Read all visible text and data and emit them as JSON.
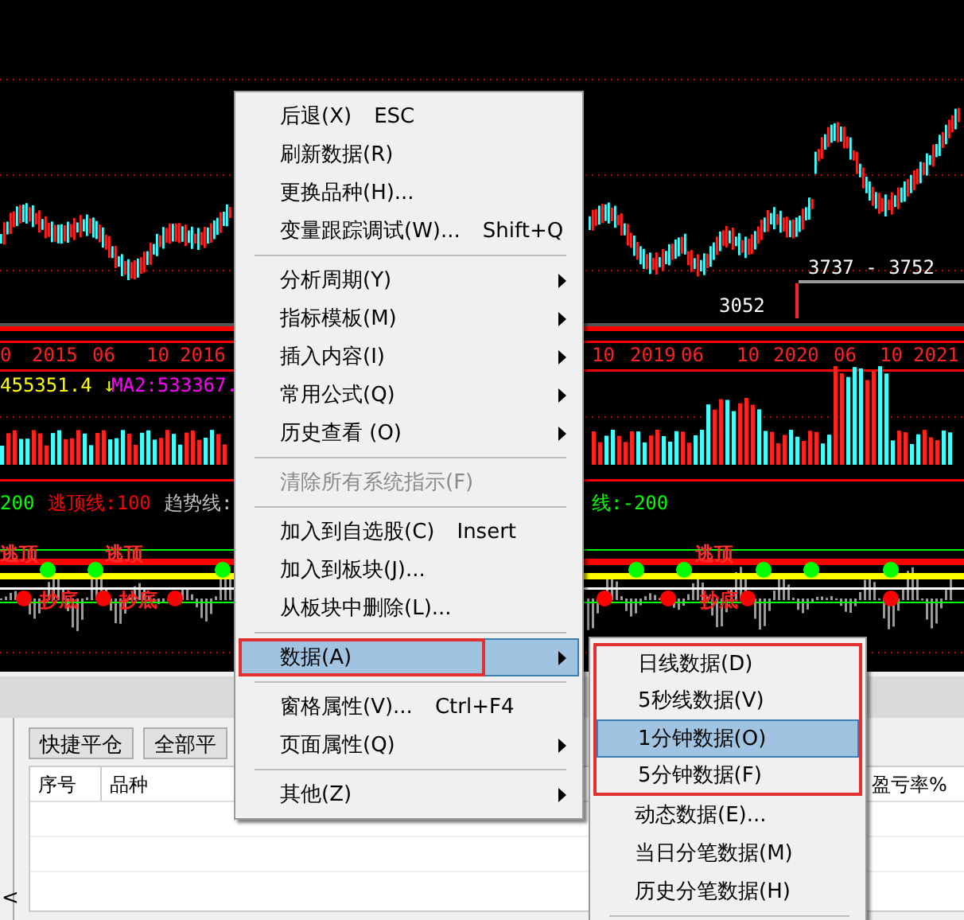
{
  "chart": {
    "price_labels": [
      {
        "text": "3737 - 3752",
        "kind": "range"
      },
      {
        "text": "3052",
        "kind": "low"
      }
    ],
    "timeline": [
      "0",
      "2015",
      "06",
      "10",
      "2016",
      "10",
      "2019",
      "06",
      "10",
      "2020",
      "06",
      "10",
      "2021"
    ],
    "volume_legend": [
      {
        "text": "455351.4 ↓",
        "color": "#ffff00"
      },
      {
        "text": "MA2:533367.",
        "color": "#ff00ff"
      }
    ],
    "oscillator_legend": [
      {
        "text": "200",
        "color": "#00ff00"
      },
      {
        "text": "逃顶线:100",
        "color": "#ff0000"
      },
      {
        "text": "趋势线:",
        "color": "#c0c0c0"
      },
      {
        "text": "线:-200",
        "color": "#00ff00"
      }
    ],
    "signals": [
      {
        "text": "逃顶",
        "kind": "top"
      },
      {
        "text": "逃顶",
        "kind": "top"
      },
      {
        "text": "逃顶",
        "kind": "top"
      },
      {
        "text": "抄底",
        "kind": "bottom"
      },
      {
        "text": "抄底",
        "kind": "bottom"
      },
      {
        "text": "抄底",
        "kind": "bottom"
      }
    ]
  },
  "panel": {
    "buttons": [
      "快捷平仓",
      "全部平"
    ],
    "columns": [
      "序号",
      "品种",
      "盈亏率%"
    ],
    "scroll_left": "<"
  },
  "menu": [
    {
      "kind": "item",
      "label": "后退(X)",
      "shortcut": "ESC",
      "submenu": false,
      "disabled": false,
      "selected": false
    },
    {
      "kind": "item",
      "label": "刷新数据(R)",
      "submenu": false,
      "disabled": false,
      "selected": false
    },
    {
      "kind": "item",
      "label": "更换品种(H)...",
      "submenu": false,
      "disabled": false,
      "selected": false
    },
    {
      "kind": "item",
      "label": "变量跟踪调试(W)...",
      "shortcut": "Shift+Q",
      "submenu": false,
      "disabled": false,
      "selected": false
    },
    {
      "kind": "separator"
    },
    {
      "kind": "item",
      "label": "分析周期(Y)",
      "submenu": true,
      "disabled": false,
      "selected": false
    },
    {
      "kind": "item",
      "label": "指标模板(M)",
      "submenu": true,
      "disabled": false,
      "selected": false
    },
    {
      "kind": "item",
      "label": "插入内容(I)",
      "submenu": true,
      "disabled": false,
      "selected": false
    },
    {
      "kind": "item",
      "label": "常用公式(Q)",
      "submenu": true,
      "disabled": false,
      "selected": false
    },
    {
      "kind": "item",
      "label": "历史查看 (O)",
      "submenu": true,
      "disabled": false,
      "selected": false
    },
    {
      "kind": "separator"
    },
    {
      "kind": "item",
      "label": "清除所有系统指示(F)",
      "submenu": false,
      "disabled": true,
      "selected": false
    },
    {
      "kind": "separator"
    },
    {
      "kind": "item",
      "label": "加入到自选股(C)",
      "shortcut": "Insert",
      "submenu": false,
      "disabled": false,
      "selected": false
    },
    {
      "kind": "item",
      "label": "加入到板块(J)...",
      "submenu": false,
      "disabled": false,
      "selected": false
    },
    {
      "kind": "item",
      "label": "从板块中删除(L)...",
      "submenu": false,
      "disabled": false,
      "selected": false
    },
    {
      "kind": "separator"
    },
    {
      "kind": "item",
      "label": "数据(A)",
      "submenu": true,
      "disabled": false,
      "selected": true,
      "framed": true
    },
    {
      "kind": "separator"
    },
    {
      "kind": "item",
      "label": "窗格属性(V)...",
      "shortcut": "Ctrl+F4",
      "submenu": false,
      "disabled": false,
      "selected": false
    },
    {
      "kind": "item",
      "label": "页面属性(Q)",
      "submenu": true,
      "disabled": false,
      "selected": false
    },
    {
      "kind": "separator"
    },
    {
      "kind": "item",
      "label": "其他(Z)",
      "submenu": true,
      "disabled": false,
      "selected": false
    }
  ],
  "submenu": [
    {
      "kind": "item",
      "label": "日线数据(D)",
      "selected": false,
      "framed": true
    },
    {
      "kind": "item",
      "label": "5秒线数据(V)",
      "selected": false,
      "framed": true
    },
    {
      "kind": "item",
      "label": "1分钟数据(O)",
      "selected": true,
      "framed": true
    },
    {
      "kind": "item",
      "label": "5分钟数据(F)",
      "selected": false,
      "framed": true
    },
    {
      "kind": "item",
      "label": "动态数据(E)...",
      "selected": false
    },
    {
      "kind": "item",
      "label": "当日分笔数据(M)",
      "selected": false
    },
    {
      "kind": "item",
      "label": "历史分笔数据(H)",
      "selected": false
    },
    {
      "kind": "separator"
    }
  ]
}
